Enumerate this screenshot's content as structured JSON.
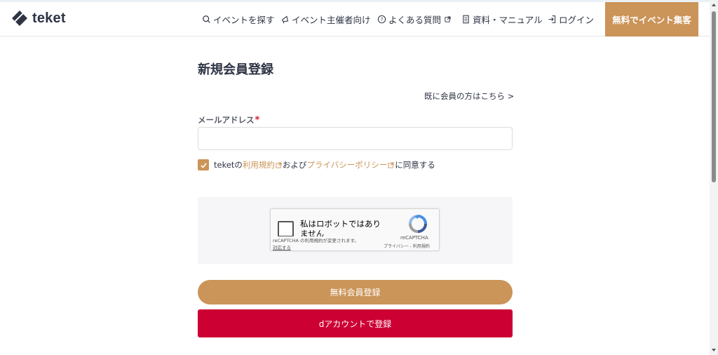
{
  "header": {
    "logo_text": "teket",
    "nav": [
      {
        "label": "イベントを探す",
        "icon": "search-icon"
      },
      {
        "label": "イベント主催者向け",
        "icon": "megaphone-icon"
      },
      {
        "label": "よくある質問",
        "icon": "question-icon"
      },
      {
        "label": "資料・マニュアル",
        "icon": "document-icon"
      },
      {
        "label": "ログイン",
        "icon": "login-icon"
      }
    ],
    "cta_label": "無料でイベント集客"
  },
  "form": {
    "title": "新規会員登録",
    "login_link": "既に会員の方はこちら >",
    "email_label": "メールアドレス",
    "required_mark": "*",
    "email_value": "",
    "agree_prefix": "teketの",
    "terms_link": "利用規約",
    "agree_middle": "および",
    "privacy_link": "プライバシーポリシー",
    "agree_suffix": "に同意する",
    "agree_checked": true,
    "register_button": "無料会員登録",
    "daccount_button": "dアカウントで登録"
  },
  "recaptcha": {
    "label": "私はロボットではありません",
    "notice": "reCAPTCHA の利用規約が変更されます。",
    "notice_link": "対応する",
    "brand": "reCAPTCHA",
    "terms": "プライバシー - 利用規約"
  },
  "colors": {
    "accent": "#cb9458",
    "daccount": "#cc0033",
    "text": "#2e3444"
  }
}
